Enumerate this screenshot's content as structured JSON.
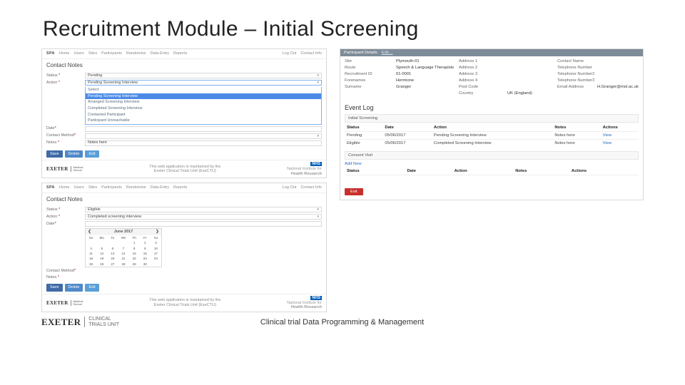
{
  "slide": {
    "title": "Recruitment Module – Initial Screening",
    "caption": "Clinical trial Data Programming & Management"
  },
  "brand": "EXETER",
  "brand_suffix_med_top": "Medical",
  "brand_suffix_med_bot": "School",
  "brand_suffix_ctu_top": "CLINICAL",
  "brand_suffix_ctu_bot": "TRIALS UNIT",
  "nav": {
    "brand_app": "SPA",
    "items": [
      "Home",
      "Users",
      "Sites",
      "Participants",
      "Randomise",
      "Data-Entry",
      "Reports"
    ],
    "right": [
      "Log Out",
      "Contact Info"
    ]
  },
  "footer_note_l1": "This web application is maintained by the",
  "footer_note_l2": "Exeter Clinical Trials Unit (ExeCTU)",
  "nhs_l1": "National Institute for",
  "nhs_l2": "Health Research",
  "contact_notes_title": "Contact Notes",
  "labels": {
    "status": "Status",
    "action": "Action",
    "date": "Date",
    "contact_method": "Contact Method",
    "notes": "Notes",
    "ast": "*"
  },
  "shot1": {
    "status_value": "Pending",
    "action_value": "Pending Screening Interview",
    "dropdown": {
      "placeholder": "Select",
      "options": [
        "Pending Screening Interview",
        "Arranged Screening Interview",
        "Completed Screening Interview",
        "Contacted Participant",
        "Participant Unreachable"
      ],
      "selected_index": 0
    },
    "notes_value": "Notes here"
  },
  "shot2": {
    "status_value": "Eligible",
    "action_value": "Completed screening interview",
    "calendar": {
      "month": "June 2017",
      "dow": [
        "Su",
        "Mo",
        "Tu",
        "We",
        "Th",
        "Fr",
        "Sa"
      ],
      "cells": [
        [
          " ",
          " ",
          " ",
          " ",
          "1",
          "2",
          "3"
        ],
        [
          "4",
          "5",
          "6",
          "7",
          "8",
          "9",
          "10"
        ],
        [
          "11",
          "12",
          "13",
          "14",
          "15",
          "16",
          "17"
        ],
        [
          "18",
          "19",
          "20",
          "21",
          "22",
          "23",
          "24"
        ],
        [
          "25",
          "26",
          "27",
          "28",
          "29",
          "30",
          " "
        ]
      ]
    }
  },
  "buttons": {
    "save": "Save",
    "delete": "Delete",
    "exit": "Exit"
  },
  "right": {
    "header": "Participant Details",
    "header_edit": "Edit…",
    "rows": [
      {
        "k": "Site",
        "v": "Plymouth-01",
        "k2": "Address 1",
        "v2": "",
        "k3": "Contact Name",
        "v3": ""
      },
      {
        "k": "Route",
        "v": "Speech & Language Therapists",
        "k2": "Address 2",
        "v2": "",
        "k3": "Telephone Number",
        "v3": ""
      },
      {
        "k": "Recruitment ID",
        "v": "01-0001",
        "k2": "Address 3",
        "v2": "",
        "k3": "Telephone Number2",
        "v3": ""
      },
      {
        "k": "Forenames",
        "v": "Hermione",
        "k2": "Address 4",
        "v2": "",
        "k3": "Telephone Number3",
        "v3": ""
      },
      {
        "k": "Surname",
        "v": "Granger",
        "k2": "Post Code",
        "v2": "",
        "k3": "Email Address",
        "v3": "H.Granger@mol.ac.uk"
      },
      {
        "k": "",
        "v": "",
        "k2": "Country",
        "v2": "UK (England)",
        "k3": "",
        "v3": ""
      }
    ],
    "event_log_title": "Event Log",
    "event_log_sub": "Initial Screening",
    "event_cols": [
      "Status",
      "Date",
      "Action",
      "Notes",
      "Actions"
    ],
    "events": [
      {
        "status": "Pending",
        "date": "05/06/2017",
        "action": "Pending Screening Interview",
        "notes": "Notes here",
        "link": "View"
      },
      {
        "status": "Eligible",
        "date": "05/06/2017",
        "action": "Completed Screening Interview",
        "notes": "Notes here",
        "link": "View"
      }
    ],
    "consent_sub": "Consent Visit",
    "add_new": "Add New",
    "consent_cols": [
      "Status",
      "Date",
      "Action",
      "Notes",
      "Actions"
    ],
    "exit": "Exit"
  }
}
